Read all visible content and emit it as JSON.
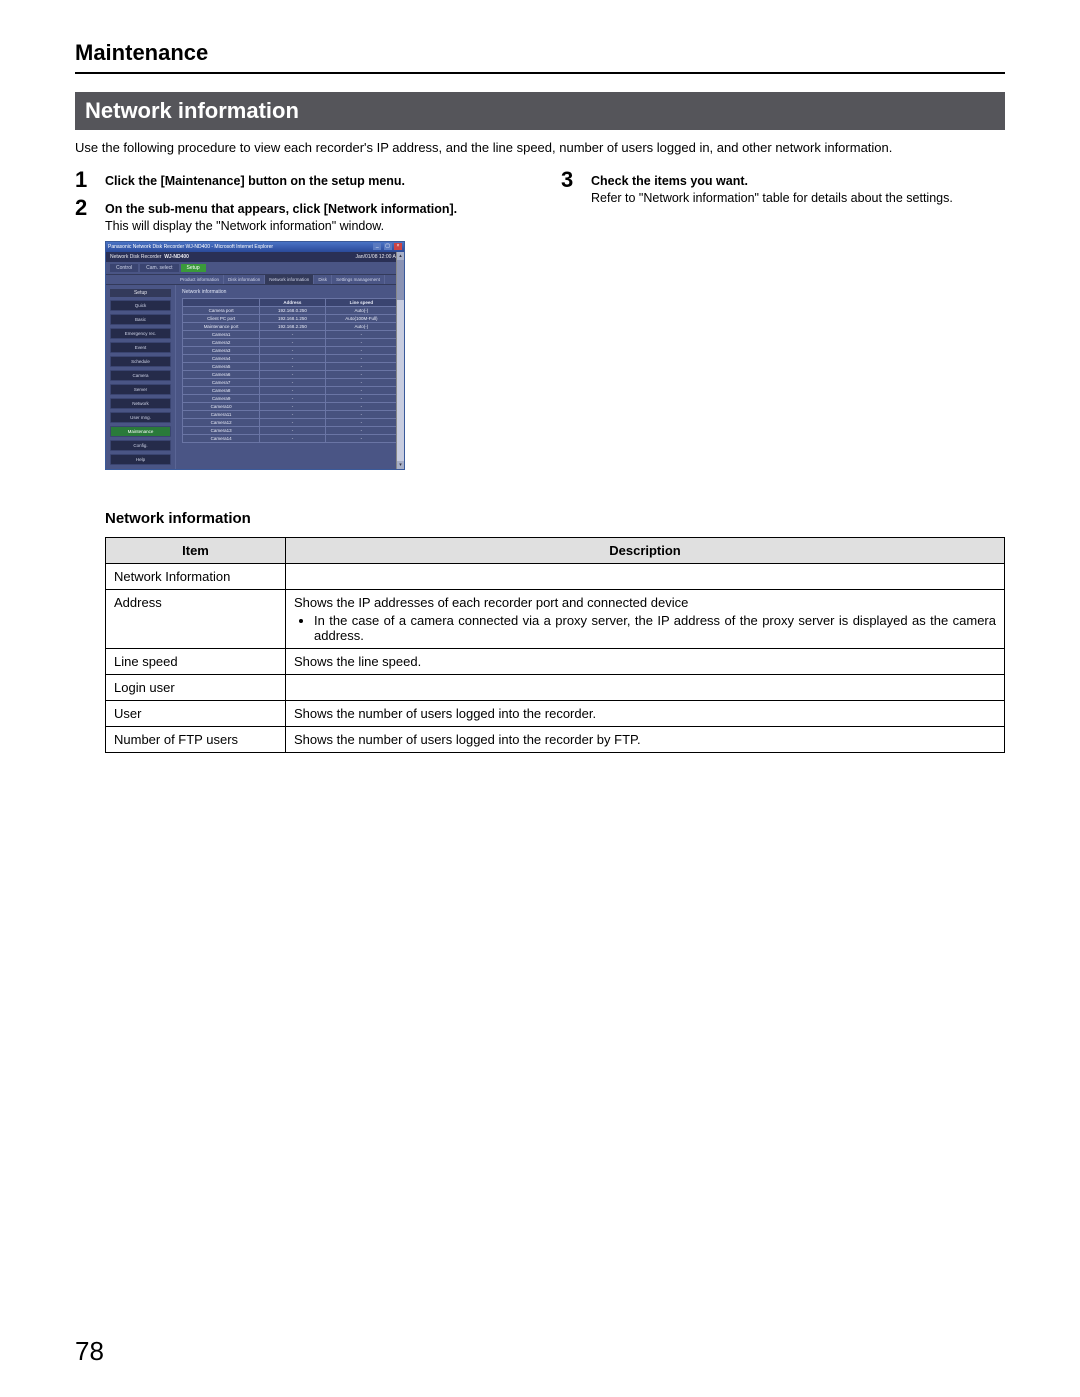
{
  "header": {
    "title": "Maintenance",
    "section": "Network information"
  },
  "intro": "Use the following procedure to view each recorder's IP address, and the line speed, number of users logged in, and other network information.",
  "steps": {
    "s1": {
      "num": "1",
      "bold": "Click the [Maintenance] button on the setup menu."
    },
    "s2": {
      "num": "2",
      "bold": "On the sub-menu that appears, click [Network information].",
      "text": "This will display the \"Network information\" window."
    },
    "s3": {
      "num": "3",
      "bold": "Check the items you want.",
      "text": "Refer to \"Network information\" table for details about the settings."
    }
  },
  "shot": {
    "titlebar": "Panasonic   Network Disk Recorder WJ-ND400 - Microsoft Internet Explorer",
    "brand": "Network Disk Recorder",
    "model": "WJ-ND400",
    "datetime": "Jan/01/08  12:00  AM",
    "top_tabs": [
      "Control",
      "Cam. select",
      "Setup"
    ],
    "maint_tabs": [
      "Product information",
      "Disk information",
      "Network information",
      "Disk",
      "Settings management"
    ],
    "side_header": "Setup",
    "side_items": [
      "Quick",
      "Basic",
      "Emergency rec.",
      "Event",
      "Schedule",
      "Camera",
      "Server",
      "Network",
      "User mng.",
      "Maintenance",
      "Config.",
      "Help"
    ],
    "panel_label": "Network information",
    "grid_headers": [
      "",
      "Address",
      "Line speed"
    ],
    "grid_rows": [
      [
        "Camera port",
        "192.168.0.250",
        "Auto(-)"
      ],
      [
        "Client PC port",
        "192.168.1.250",
        "Auto(100M-Full)"
      ],
      [
        "Maintenance port",
        "192.168.2.250",
        "Auto(-)"
      ],
      [
        "Camera1",
        "-",
        "-"
      ],
      [
        "Camera2",
        "-",
        "-"
      ],
      [
        "Camera3",
        "-",
        "-"
      ],
      [
        "Camera4",
        "-",
        "-"
      ],
      [
        "Camera5",
        "-",
        "-"
      ],
      [
        "Camera6",
        "-",
        "-"
      ],
      [
        "Camera7",
        "-",
        "-"
      ],
      [
        "Camera8",
        "-",
        "-"
      ],
      [
        "Camera9",
        "-",
        "-"
      ],
      [
        "Camera10",
        "-",
        "-"
      ],
      [
        "Camera11",
        "-",
        "-"
      ],
      [
        "Camera12",
        "-",
        "-"
      ],
      [
        "Camera13",
        "-",
        "-"
      ],
      [
        "Camera14",
        "-",
        "-"
      ]
    ]
  },
  "subheading": "Network information",
  "table": {
    "th_item": "Item",
    "th_desc": "Description",
    "rows": [
      {
        "item": "Network Information",
        "desc": ""
      },
      {
        "item": "Address",
        "desc": "Shows the IP addresses of each recorder port and connected device",
        "bullet": "In the case of a camera connected via a proxy server, the IP address of the proxy server is displayed as the camera address."
      },
      {
        "item": "Line speed",
        "desc": "Shows the line speed."
      },
      {
        "item": "Login user",
        "desc": ""
      },
      {
        "item": "User",
        "desc": "Shows the number of users logged into the recorder."
      },
      {
        "item": "Number of FTP users",
        "desc": "Shows the number of users logged into the recorder by FTP."
      }
    ]
  },
  "page_number": "78"
}
